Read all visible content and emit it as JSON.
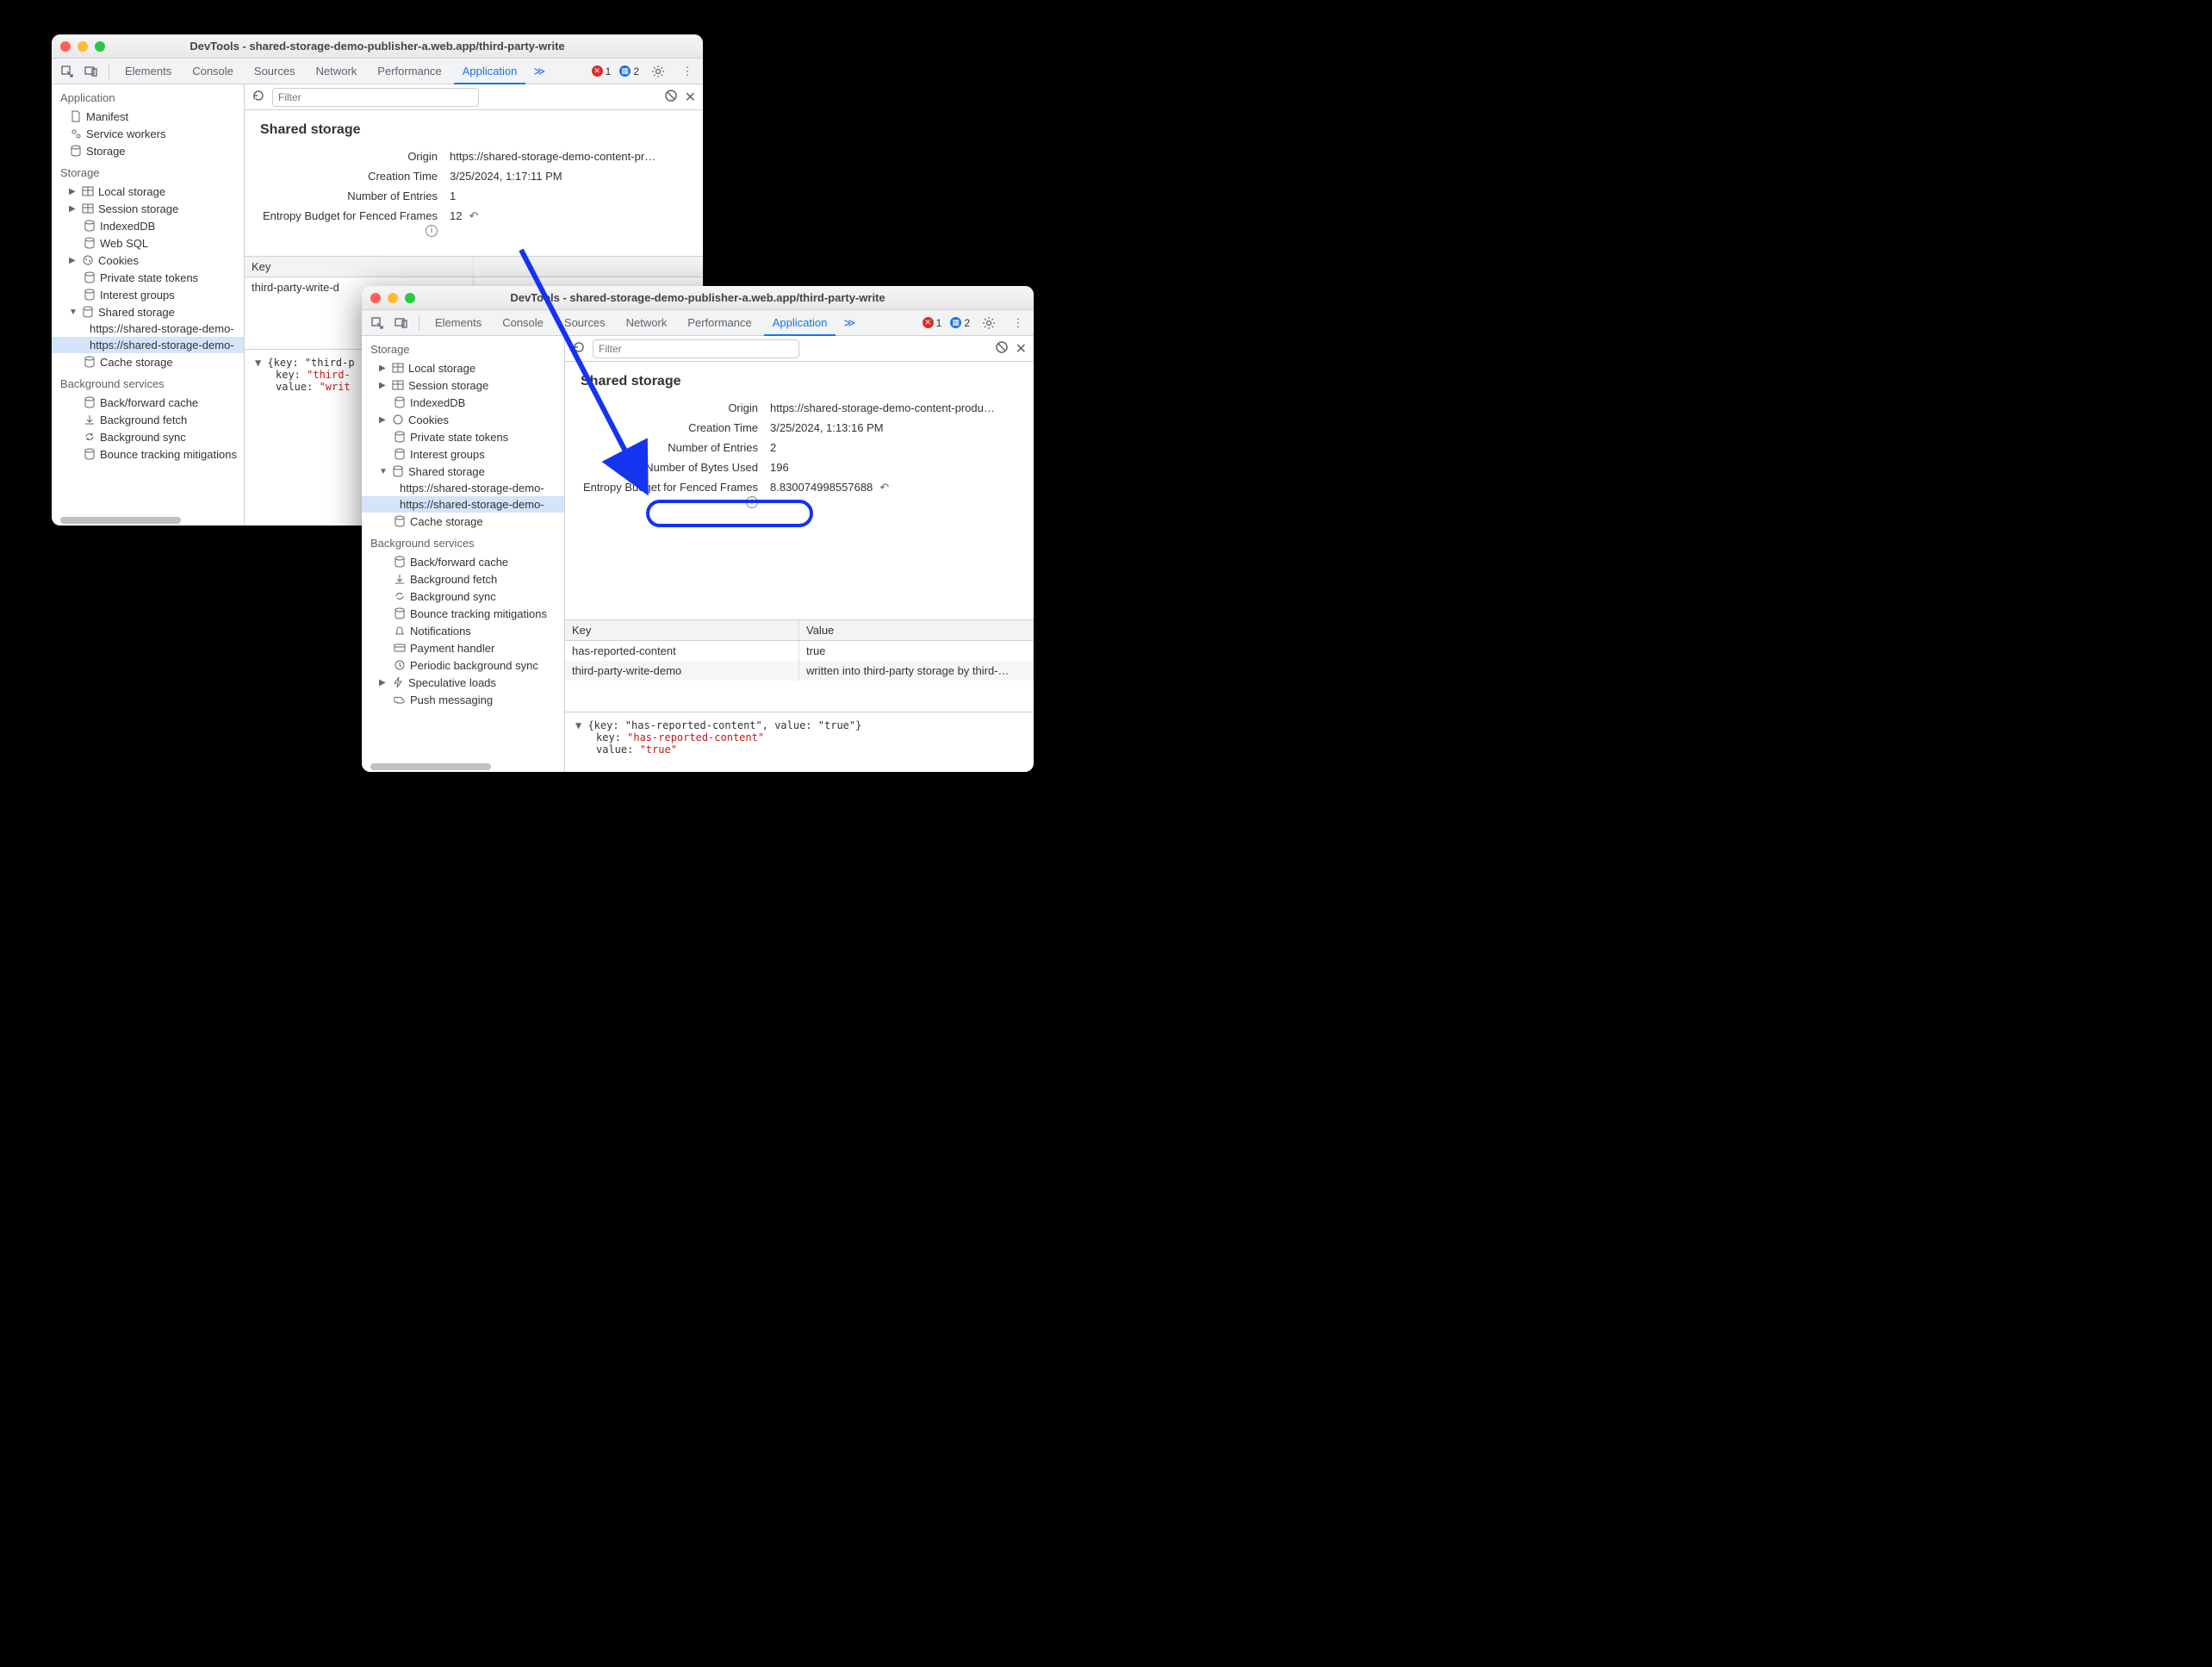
{
  "win1": {
    "title": "DevTools - shared-storage-demo-publisher-a.web.app/third-party-write",
    "tabs": [
      "Elements",
      "Console",
      "Sources",
      "Network",
      "Performance",
      "Application"
    ],
    "errors": 1,
    "messages": 2,
    "filter_placeholder": "Filter",
    "sidebar": {
      "application": "Application",
      "manifest": "Manifest",
      "service_workers": "Service workers",
      "storage": "Storage",
      "storage_h": "Storage",
      "local": "Local storage",
      "session": "Session storage",
      "indexed": "IndexedDB",
      "websql": "Web SQL",
      "cookies": "Cookies",
      "pst": "Private state tokens",
      "ig": "Interest groups",
      "shared": "Shared storage",
      "ss1": "https://shared-storage-demo-",
      "ss2": "https://shared-storage-demo-",
      "cache": "Cache storage",
      "bgs": "Background services",
      "bf": "Back/forward cache",
      "bfetch": "Background fetch",
      "bsync": "Background sync",
      "btm": "Bounce tracking mitigations"
    },
    "panel": {
      "heading": "Shared storage",
      "origin_k": "Origin",
      "origin_v": "https://shared-storage-demo-content-pr…",
      "ctime_k": "Creation Time",
      "ctime_v": "3/25/2024, 1:17:11 PM",
      "entries_k": "Number of Entries",
      "entries_v": "1",
      "budget_k": "Entropy Budget for Fenced Frames",
      "budget_v": "12"
    },
    "table": {
      "key_h": "Key",
      "row1_k": "third-party-write-d"
    },
    "detail": {
      "pre": "{key: \"third-p",
      "k": "key: ",
      "kv": "\"third-",
      "v": "value: ",
      "vv": "\"writ"
    }
  },
  "win2": {
    "title": "DevTools - shared-storage-demo-publisher-a.web.app/third-party-write",
    "tabs": [
      "Elements",
      "Console",
      "Sources",
      "Network",
      "Performance",
      "Application"
    ],
    "errors": 1,
    "messages": 2,
    "filter_placeholder": "Filter",
    "sidebar": {
      "storage_h": "Storage",
      "local": "Local storage",
      "session": "Session storage",
      "indexed": "IndexedDB",
      "cookies": "Cookies",
      "pst": "Private state tokens",
      "ig": "Interest groups",
      "shared": "Shared storage",
      "ss1": "https://shared-storage-demo-",
      "ss2": "https://shared-storage-demo-",
      "cache": "Cache storage",
      "bgs": "Background services",
      "bf": "Back/forward cache",
      "bfetch": "Background fetch",
      "bsync": "Background sync",
      "btm": "Bounce tracking mitigations",
      "notif": "Notifications",
      "pay": "Payment handler",
      "psync": "Periodic background sync",
      "spec": "Speculative loads",
      "push": "Push messaging"
    },
    "panel": {
      "heading": "Shared storage",
      "origin_k": "Origin",
      "origin_v": "https://shared-storage-demo-content-produ…",
      "ctime_k": "Creation Time",
      "ctime_v": "3/25/2024, 1:13:16 PM",
      "entries_k": "Number of Entries",
      "entries_v": "2",
      "bytes_k": "Number of Bytes Used",
      "bytes_v": "196",
      "budget_k": "Entropy Budget for Fenced Frames",
      "budget_v": "8.830074998557688"
    },
    "table": {
      "key_h": "Key",
      "val_h": "Value",
      "r1_k": "has-reported-content",
      "r1_v": "true",
      "r2_k": "third-party-write-demo",
      "r2_v": "written into third-party storage by third-…"
    },
    "detail": {
      "line1": "{key: \"has-reported-content\", value: \"true\"}",
      "k": "key: ",
      "kv": "\"has-reported-content\"",
      "v": "value: ",
      "vv": "\"true\""
    }
  }
}
